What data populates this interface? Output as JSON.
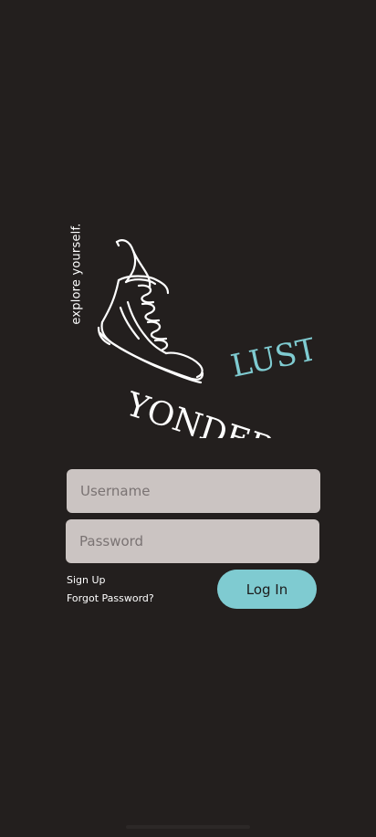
{
  "brand": {
    "tagline": "explore yourself.",
    "word_part1": "YONDER",
    "word_part2": "LUST",
    "accent_color": "#7fcbd1",
    "logo_icon": "sneaker-icon"
  },
  "form": {
    "username_placeholder": "Username",
    "password_placeholder": "Password",
    "login_label": "Log In"
  },
  "links": {
    "signup": "Sign Up",
    "forgot": "Forgot Password?"
  },
  "colors": {
    "background": "#231f1e",
    "input_bg": "#cbc4c2",
    "button_bg": "#7fcbd1"
  }
}
